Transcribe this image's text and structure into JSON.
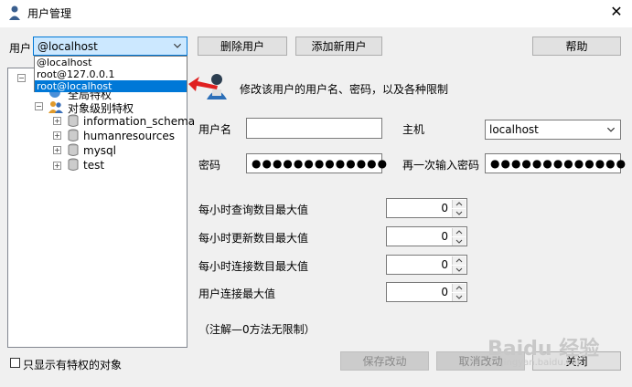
{
  "window": {
    "title": "用户管理",
    "close_glyph": "✕"
  },
  "user_label": "用户",
  "user_combo": {
    "value": "@localhost"
  },
  "user_dropdown": {
    "options": [
      "@localhost",
      "root@127.0.0.1",
      "root@localhost"
    ],
    "selected_index": 2
  },
  "toolbar": {
    "delete_user": "删除用户",
    "add_user": "添加新用户",
    "help": "帮助"
  },
  "tree": {
    "partial_item": "全局特权",
    "object_root": "对象级别特权",
    "databases": [
      "information_schema",
      "humanresources",
      "mysql",
      "test"
    ]
  },
  "hint": "修改该用户的用户名、密码，以及各种限制",
  "form": {
    "username_label": "用户名",
    "username_value": "",
    "host_label": "主机",
    "host_value": "localhost",
    "password_label": "密码",
    "password_value": "●●●●●●●●●●●●●",
    "confirm_label": "再一次输入密码",
    "confirm_value": "●●●●●●●●●●●●●"
  },
  "limits": [
    {
      "label": "每小时查询数目最大值",
      "value": "0"
    },
    {
      "label": "每小时更新数目最大值",
      "value": "0"
    },
    {
      "label": "每小时连接数目最大值",
      "value": "0"
    },
    {
      "label": "用户连接最大值",
      "value": "0"
    }
  ],
  "note": "（注解—0方法无限制）",
  "only_privileged_checkbox": "只显示有特权的对象",
  "footer": {
    "save": "保存改动",
    "cancel": "取消改动",
    "close": "关闭"
  },
  "watermark": {
    "brand": "Baidu 经验",
    "url": "jingyan.baidu.com"
  },
  "colors": {
    "selection": "#0078d7",
    "focus_bg": "#cce8ff",
    "arrow_red": "#e02020"
  }
}
